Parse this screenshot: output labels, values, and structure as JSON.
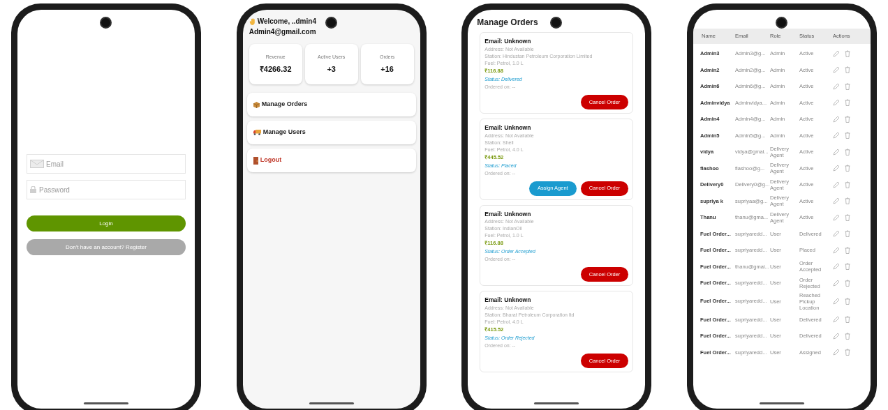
{
  "login": {
    "email": {
      "placeholder": "Email"
    },
    "password": {
      "placeholder": "Password"
    },
    "buttons": [
      {
        "label": "Login",
        "kind": "primary"
      },
      {
        "label": "Don't have an account? Register",
        "kind": "secondary"
      }
    ]
  },
  "dashboard": {
    "greeting": "Welcome, ..dmin4",
    "email": "Admin4@gmail.com",
    "stats": [
      {
        "label": "Revenue",
        "value": "₹4266.32"
      },
      {
        "label": "Active Users",
        "value": "+3"
      },
      {
        "label": "Orders",
        "value": "+16"
      }
    ],
    "menu": [
      {
        "label": "Manage Orders",
        "kind": "orders"
      },
      {
        "label": "Manage Users",
        "kind": "users"
      },
      {
        "label": "Logout",
        "kind": "logout"
      }
    ]
  },
  "orders": {
    "title": "Manage Orders",
    "cards": [
      {
        "email": "Email: Unknown",
        "address": "Address: Not Available",
        "station": "Station: Hindustan Petroleum Corporation Limited",
        "fuel": "Fuel: Petrol, 1.0 L",
        "price": "₹116.88",
        "status": "Status: Delivered",
        "ordered_on": "Ordered on: --",
        "buttons": [
          {
            "label": "Cancel Order",
            "kind": "cancel"
          }
        ]
      },
      {
        "email": "Email: Unknown",
        "address": "Address: Not Available",
        "station": "Station: Shell",
        "fuel": "Fuel: Petrol, 4.0 L",
        "price": "₹445.52",
        "status": "Status: Placed",
        "ordered_on": "Ordered on: --",
        "buttons": [
          {
            "label": "Assign Agent",
            "kind": "assign"
          },
          {
            "label": "Cancel Order",
            "kind": "cancel"
          }
        ]
      },
      {
        "email": "Email: Unknown",
        "address": "Address: Not Available",
        "station": "Station: IndianOil",
        "fuel": "Fuel: Petrol, 1.0 L",
        "price": "₹116.88",
        "status": "Status: Order Accepted",
        "ordered_on": "Ordered on: --",
        "buttons": [
          {
            "label": "Cancel Order",
            "kind": "cancel"
          }
        ]
      },
      {
        "email": "Email: Unknown",
        "address": "Address: Not Available",
        "station": "Station: Bharat Petroleum Corporation ltd",
        "fuel": "Fuel: Petrol, 4.0 L",
        "price": "₹415.52",
        "status": "Status: Order Rejected",
        "ordered_on": "Ordered on: --",
        "buttons": [
          {
            "label": "Cancel Order",
            "kind": "cancel"
          }
        ]
      }
    ]
  },
  "users": {
    "columns": [
      "Name",
      "Email",
      "Role",
      "Status",
      "Actions"
    ],
    "rows": [
      {
        "name": "Admin3",
        "email": "Admin3@g...",
        "role": "Admin",
        "status": "Active"
      },
      {
        "name": "Admin2",
        "email": "Admin2@g...",
        "role": "Admin",
        "status": "Active"
      },
      {
        "name": "Admin6",
        "email": "Admin6@g...",
        "role": "Admin",
        "status": "Active"
      },
      {
        "name": "Adminvidya",
        "email": "Adminvidya...",
        "role": "Admin",
        "status": "Active"
      },
      {
        "name": "Admin4",
        "email": "Admin4@g...",
        "role": "Admin",
        "status": "Active"
      },
      {
        "name": "Admin5",
        "email": "Admin5@g...",
        "role": "Admin",
        "status": "Active"
      },
      {
        "name": "vidya",
        "email": "vidya@gmai...",
        "role": "Delivery Agent",
        "status": "Active"
      },
      {
        "name": "flashoo",
        "email": "flashoo@g...",
        "role": "Delivery Agent",
        "status": "Active"
      },
      {
        "name": "Delivery0",
        "email": "Delivery0@g...",
        "role": "Delivery Agent",
        "status": "Active"
      },
      {
        "name": "supriya k",
        "email": "supriyaa@g...",
        "role": "Delivery Agent",
        "status": "Active"
      },
      {
        "name": "Thanu",
        "email": "thanu@gma...",
        "role": "Delivery Agent",
        "status": "Active"
      },
      {
        "name": "Fuel Order...",
        "email": "supriyaredd...",
        "role": "User",
        "status": "Delivered"
      },
      {
        "name": "Fuel Order...",
        "email": "supriyaredd...",
        "role": "User",
        "status": "Placed"
      },
      {
        "name": "Fuel Order...",
        "email": "thanu@gmai...",
        "role": "User",
        "status": "Order Accepted"
      },
      {
        "name": "Fuel Order...",
        "email": "supriyaredd...",
        "role": "User",
        "status": "Order Rejected"
      },
      {
        "name": "Fuel Order...",
        "email": "supriyaredd...",
        "role": "User",
        "status": "Reached Pickup Location"
      },
      {
        "name": "Fuel Order...",
        "email": "supriyaredd...",
        "role": "User",
        "status": "Delivered"
      },
      {
        "name": "Fuel Order...",
        "email": "supriyaredd...",
        "role": "User",
        "status": "Delivered"
      },
      {
        "name": "Fuel Order...",
        "email": "supriyaredd...",
        "role": "User",
        "status": "Assigned"
      }
    ]
  }
}
